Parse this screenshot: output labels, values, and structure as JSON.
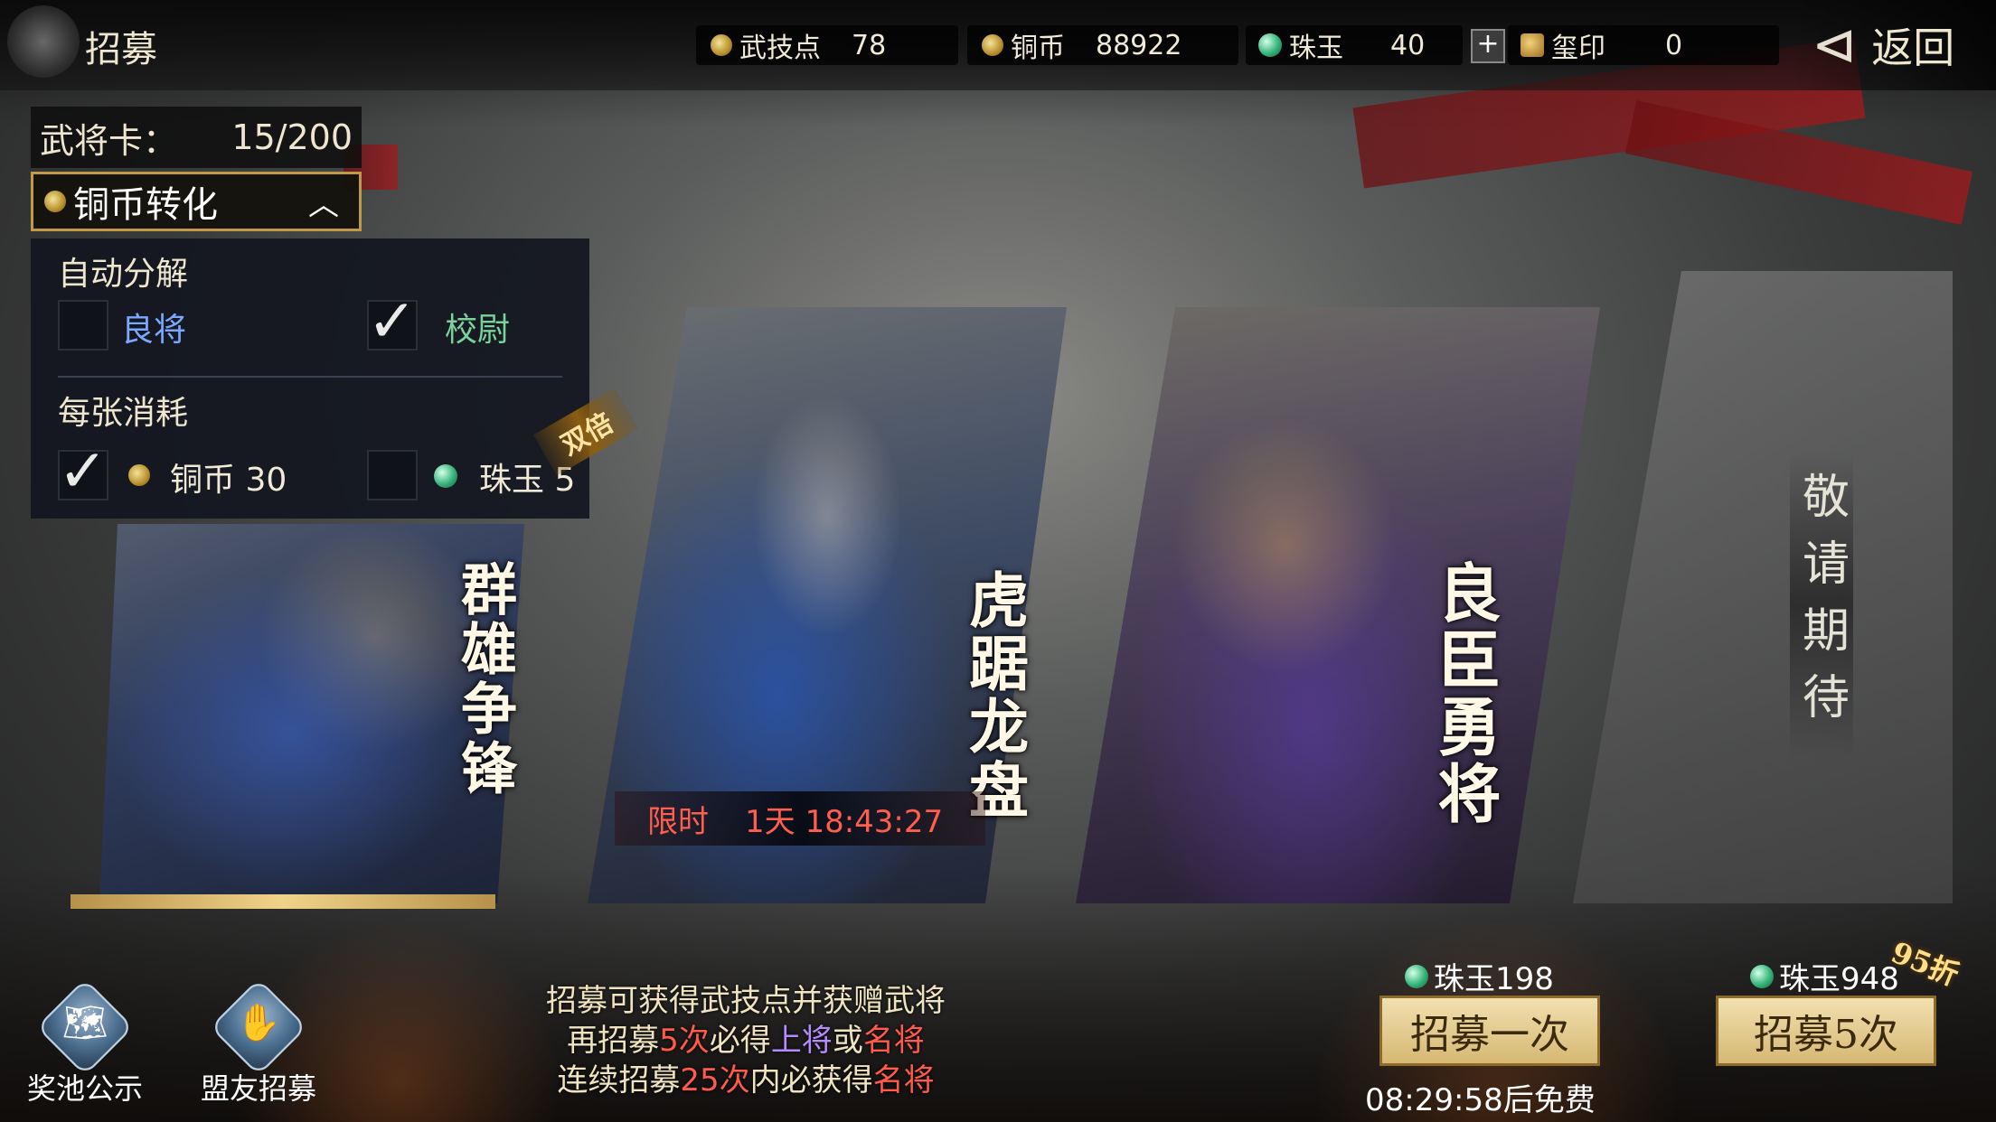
{
  "header": {
    "title": "招募",
    "resources": [
      {
        "label": "武技点",
        "value": "78"
      },
      {
        "label": "铜币",
        "value": "88922"
      },
      {
        "label": "珠玉",
        "value": "40"
      },
      {
        "label": "玺印",
        "value": "0"
      }
    ],
    "plus_label": "+",
    "back_label": "返回"
  },
  "cards_panel": {
    "label": "武将卡：",
    "count": "15/200",
    "convert_label": "铜币转化",
    "auto_decompose_title": "自动分解",
    "option_liangjiang": "良将",
    "option_xiaowei": "校尉",
    "cost_title": "每张消耗",
    "cost_copper": "铜币 30",
    "cost_jade": "珠玉 5",
    "checked": {
      "liangjiang": false,
      "xiaowei": true,
      "copper": true,
      "jade": false
    }
  },
  "banners": {
    "double_badge": "双倍",
    "banner1": "群雄争锋",
    "banner2": "虎踞龙盘",
    "banner3": "良臣勇将",
    "banner4": "敬请期待",
    "limited_label": "限时",
    "limited_timer": "1天 18:43:27"
  },
  "bottom": {
    "pool_notice": "奖池公示",
    "ally_recruit": "盟友招募",
    "info_line1": "招募可获得武技点并获赠武将",
    "info_line2_a": "再招募",
    "info_line2_b": "5次",
    "info_line2_c": "必得",
    "info_line2_d": "上将",
    "info_line2_e": "或",
    "info_line2_f": "名将",
    "info_line3_a": "连续招募",
    "info_line3_b": "25次",
    "info_line3_c": "内必获得",
    "info_line3_d": "名将",
    "cost_once": "珠玉198",
    "cost_five": "珠玉948",
    "btn_once": "招募一次",
    "btn_five": "招募5次",
    "free_timer": "08:29:58后免费",
    "discount": "95折"
  }
}
